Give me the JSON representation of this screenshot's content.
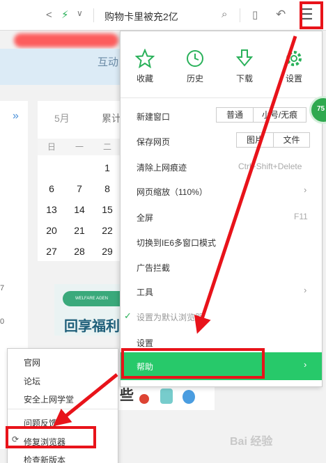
{
  "toolbar": {
    "search_text": "购物卡里被充2亿",
    "icons": [
      "share-icon",
      "lightning-icon",
      "chevron-down-icon",
      "search-icon",
      "phone-icon",
      "undo-icon",
      "hamburger-menu-icon"
    ]
  },
  "banner": {
    "text": "互动"
  },
  "calendar": {
    "month": "5月",
    "tab2": "累计",
    "days_of_week": [
      "日",
      "一",
      "二"
    ],
    "rows": [
      [
        "",
        "",
        "1"
      ],
      [
        "6",
        "7",
        "8"
      ],
      [
        "13",
        "14",
        "15"
      ],
      [
        "20",
        "21",
        "22"
      ],
      [
        "27",
        "28",
        "29"
      ]
    ],
    "side_numbers": [
      "7",
      "0",
      "7",
      "0"
    ]
  },
  "welfare": {
    "badge": "WELFARE AGEN",
    "text": "回享福利"
  },
  "product": {
    "text": "些"
  },
  "menu": {
    "quick": [
      {
        "label": "收藏",
        "icon": "star-icon"
      },
      {
        "label": "历史",
        "icon": "clock-icon"
      },
      {
        "label": "下载",
        "icon": "download-icon"
      },
      {
        "label": "设置",
        "icon": "gear-icon"
      }
    ],
    "items": {
      "new_window": "新建窗口",
      "new_window_options": [
        "普通",
        "小号/无痕"
      ],
      "save_page": "保存网页",
      "save_page_options": [
        "图片",
        "文件"
      ],
      "clear_history": "清除上网痕迹",
      "clear_history_shortcut": "Ctrl+Shift+Delete",
      "zoom": "网页缩放（110%）",
      "fullscreen": "全屏",
      "fullscreen_shortcut": "F11",
      "ie6_mode": "切换到IE6多窗口模式",
      "adblock": "广告拦截",
      "tools": "工具",
      "default_browser": "设置为默认浏览器",
      "settings": "设置",
      "help": "帮助"
    }
  },
  "submenu": {
    "items": [
      "官网",
      "论坛",
      "安全上网学堂",
      "问题反馈",
      "修复浏览器",
      "检查新版本"
    ]
  },
  "badge": {
    "value": "75"
  },
  "watermark": "Bai 经验",
  "colors": {
    "accent_green": "#27c96a",
    "annotation_red": "#e8131a"
  }
}
